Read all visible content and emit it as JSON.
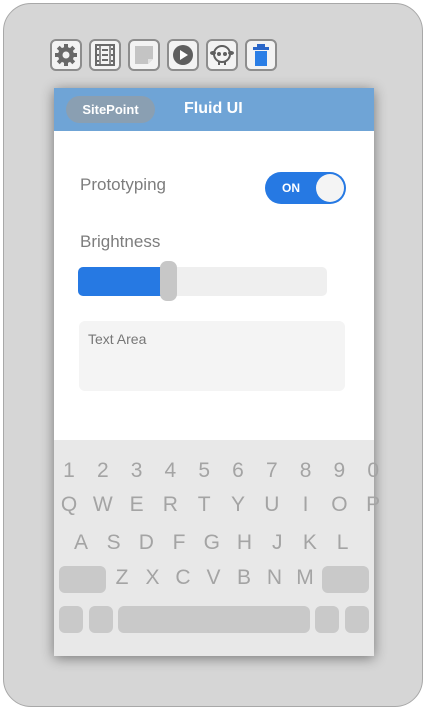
{
  "toolbar": {
    "items": [
      {
        "icon": "gear-icon"
      },
      {
        "icon": "film-icon"
      },
      {
        "icon": "page-icon"
      },
      {
        "icon": "play-icon"
      },
      {
        "icon": "sheep-icon"
      },
      {
        "icon": "trash-icon"
      }
    ]
  },
  "header": {
    "brand": "SitePoint",
    "title": "Fluid UI"
  },
  "settings": {
    "prototyping_label": "Prototyping",
    "toggle_text": "ON",
    "toggle_on": true,
    "brightness_label": "Brightness",
    "brightness_value": 0.36
  },
  "textarea": {
    "placeholder": "Text Area"
  },
  "keyboard": {
    "row1": [
      "1",
      "2",
      "3",
      "4",
      "5",
      "6",
      "7",
      "8",
      "9",
      "0"
    ],
    "row2": [
      "Q",
      "W",
      "E",
      "R",
      "T",
      "Y",
      "U",
      "I",
      "O",
      "P"
    ],
    "row3": [
      "A",
      "S",
      "D",
      "F",
      "G",
      "H",
      "J",
      "K",
      "L"
    ],
    "row4": [
      "Z",
      "X",
      "C",
      "V",
      "B",
      "N",
      "M"
    ]
  },
  "colors": {
    "accent": "#2679e3",
    "header": "#6fa4d6"
  }
}
